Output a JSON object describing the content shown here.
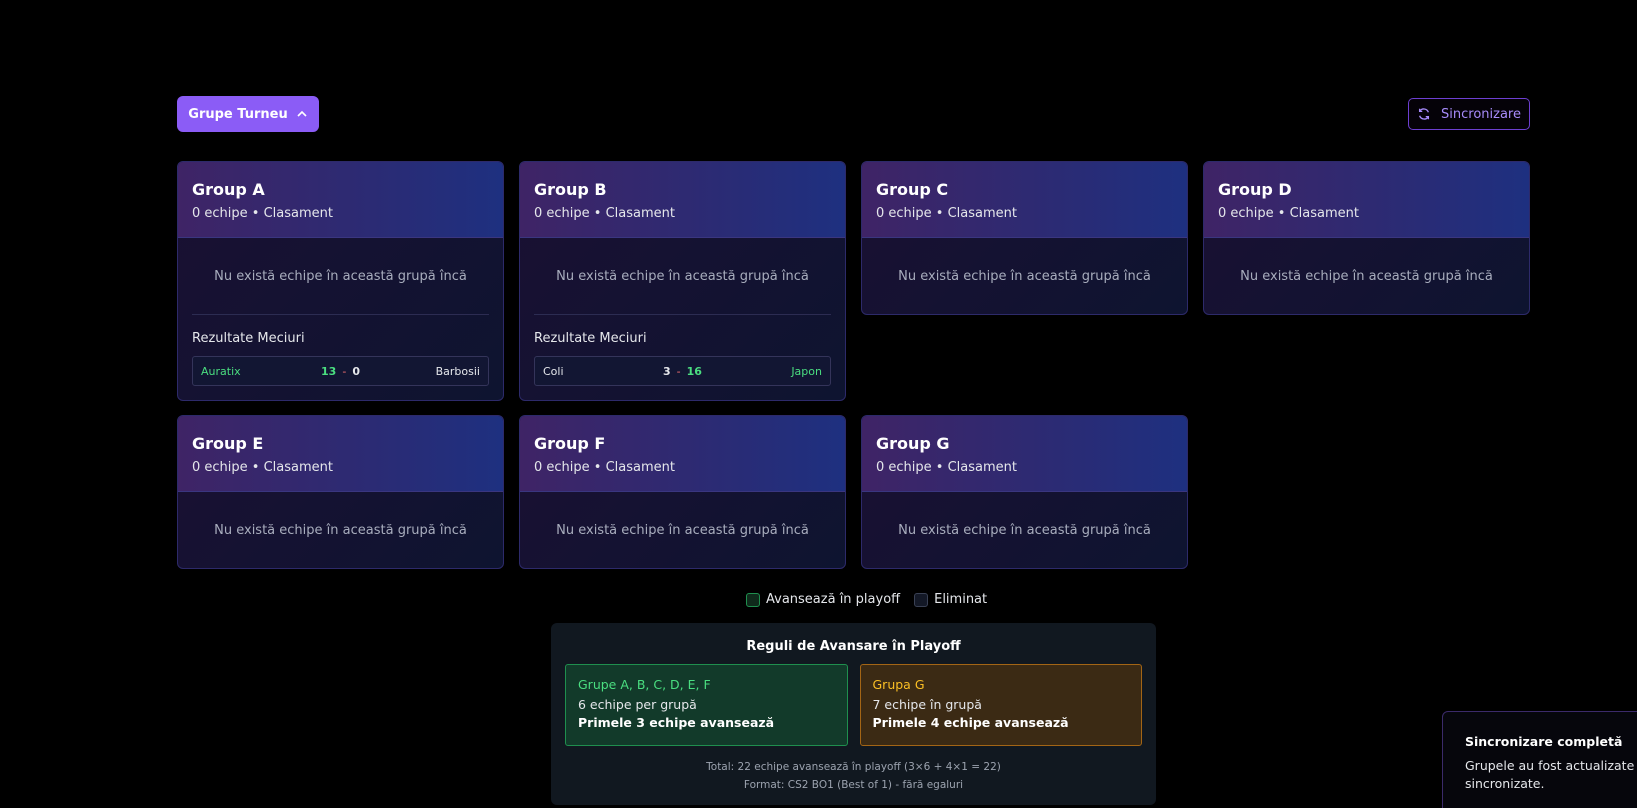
{
  "toolbar": {
    "toggle_label": "Grupe Turneu",
    "sync_label": "Sincronizare"
  },
  "groups": [
    {
      "title": "Group A",
      "subtitle": "0 echipe • Clasament",
      "empty": "Nu există echipe în această grupă încă",
      "results_title": "Rezultate Meciuri",
      "match": {
        "team1": "Auratix",
        "score1": "13",
        "sep": "-",
        "score2": "0",
        "team2": "Barbosii"
      }
    },
    {
      "title": "Group B",
      "subtitle": "0 echipe • Clasament",
      "empty": "Nu există echipe în această grupă încă",
      "results_title": "Rezultate Meciuri",
      "match": {
        "team1": "Coli",
        "score1": "3",
        "sep": "-",
        "score2": "16",
        "team2": "Japon"
      }
    },
    {
      "title": "Group C",
      "subtitle": "0 echipe • Clasament",
      "empty": "Nu există echipe în această grupă încă"
    },
    {
      "title": "Group D",
      "subtitle": "0 echipe • Clasament",
      "empty": "Nu există echipe în această grupă încă"
    },
    {
      "title": "Group E",
      "subtitle": "0 echipe • Clasament",
      "empty": "Nu există echipe în această grupă încă"
    },
    {
      "title": "Group F",
      "subtitle": "0 echipe • Clasament",
      "empty": "Nu există echipe în această grupă încă"
    },
    {
      "title": "Group G",
      "subtitle": "0 echipe • Clasament",
      "empty": "Nu există echipe în această grupă încă"
    }
  ],
  "legend": {
    "advance": "Avansează în playoff",
    "eliminated": "Eliminat"
  },
  "rules": {
    "title": "Reguli de Avansare în Playoff",
    "box1": {
      "head": "Grupe A, B, C, D, E, F",
      "line1": "6 echipe per grupă",
      "line2": "Primele 3 echipe avansează"
    },
    "box2": {
      "head": "Grupa G",
      "line1": "7 echipe în grupă",
      "line2": "Primele 4 echipe avansează"
    },
    "total": "Total: 22 echipe avansează în playoff (3×6 + 4×1 = 22)",
    "format": "Format: CS2 BO1 (Best of 1) - fără egaluri"
  },
  "toast": {
    "title": "Sincronizare completă",
    "line1": "Grupele au fost actualizate cu s",
    "line2": "sincronizate."
  },
  "colors": {
    "accent": "#8b5cf6",
    "win": "#4ade80",
    "advance_border": "#1f8f4e",
    "group_g": "#fbbf24"
  }
}
